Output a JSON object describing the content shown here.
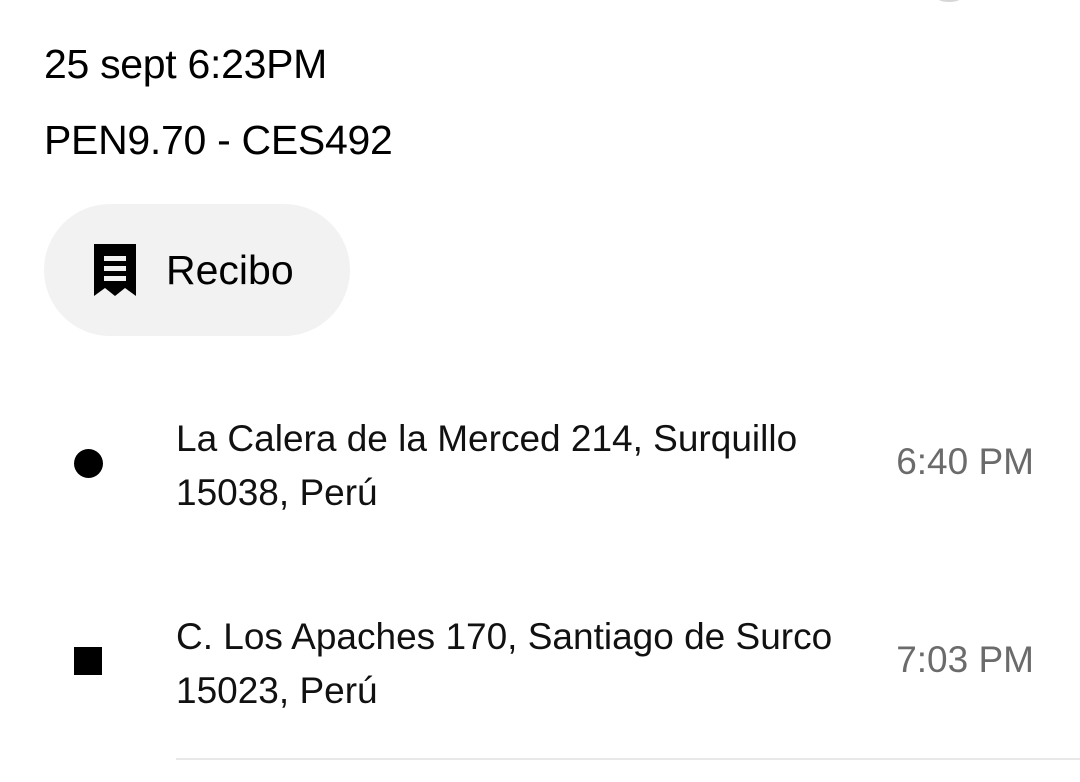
{
  "trip": {
    "datetime": "25 sept 6:23PM",
    "fare_and_plate": "PEN9.70 - CES492"
  },
  "receipt_button": {
    "label": "Recibo",
    "icon": "receipt-icon"
  },
  "stops": [
    {
      "marker": "dot-icon",
      "address": "La Calera de la Merced 214, Surquillo 15038, Perú",
      "time": "6:40 PM"
    },
    {
      "marker": "square-icon",
      "address": "C. Los Apaches 170, Santiago de Surco 15023, Perú",
      "time": "7:03 PM"
    }
  ],
  "colors": {
    "text_primary": "#000000",
    "text_secondary": "#6b6b6b",
    "button_background": "#f2f2f2",
    "divider": "#e8e8e8"
  }
}
